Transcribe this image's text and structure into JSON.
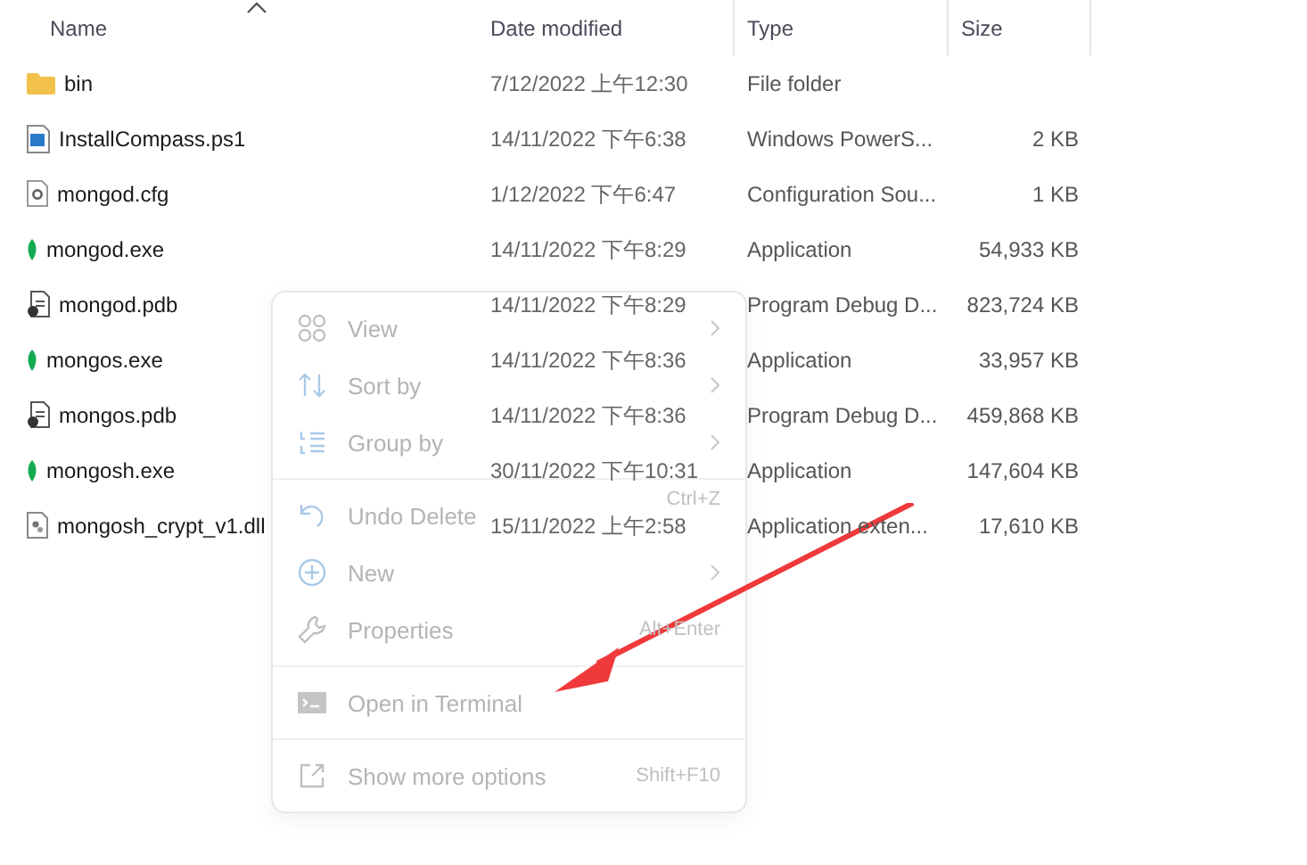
{
  "table": {
    "columns": [
      {
        "label": "Name",
        "sorted": true
      },
      {
        "label": "Date modified",
        "sorted": false
      },
      {
        "label": "Type",
        "sorted": false
      },
      {
        "label": "Size",
        "sorted": false
      }
    ],
    "rows": [
      {
        "kind": "folder",
        "name": "bin",
        "date": "7/12/2022 上午12:30",
        "type": "File folder"
      },
      {
        "kind": "script",
        "name": "InstallCompass.ps1",
        "date": "14/11/2022 下午6:38",
        "type": "Windows PowerS...",
        "size": "2 KB"
      },
      {
        "kind": "config",
        "name": "mongod.cfg",
        "date": "1/12/2022 下午6:47",
        "type": "Configuration Sou...",
        "size": "1 KB"
      },
      {
        "kind": "exe",
        "name": "mongod.exe",
        "date": "14/11/2022 下午8:29",
        "type": "Application",
        "size": "54,933 KB"
      },
      {
        "kind": "pdb",
        "name": "mongod.pdb",
        "date": "14/11/2022 下午8:29",
        "type": "Program Debug D...",
        "size": "823,724 KB"
      },
      {
        "kind": "exe",
        "name": "mongos.exe",
        "date": "14/11/2022 下午8:36",
        "type": "Application",
        "size": "33,957 KB"
      },
      {
        "kind": "pdb",
        "name": "mongos.pdb",
        "date": "14/11/2022 下午8:36",
        "type": "Program Debug D...",
        "size": "459,868 KB"
      },
      {
        "kind": "exe",
        "name": "mongosh.exe",
        "date": "30/11/2022 下午10:31",
        "type": "Application",
        "size": "147,604 KB"
      },
      {
        "kind": "dll",
        "name": "mongosh_crypt_v1.dll",
        "date": "15/11/2022 上午2:58",
        "type": "Application exten...",
        "size": "17,610 KB"
      }
    ]
  },
  "context_menu": {
    "groups": [
      [
        {
          "kind": "view",
          "label": "View",
          "submenu": true
        },
        {
          "kind": "sort",
          "label": "Sort by",
          "submenu": true
        },
        {
          "kind": "group",
          "label": "Group by",
          "submenu": true
        }
      ],
      [
        {
          "kind": "undo",
          "label": "Undo Delete",
          "shortcut": "Ctrl+Z",
          "submenu": false
        },
        {
          "kind": "new",
          "label": "New",
          "submenu": true
        },
        {
          "kind": "properties",
          "label": "Properties",
          "shortcut": "Alt+Enter",
          "submenu": false
        }
      ],
      [
        {
          "kind": "terminal",
          "label": "Open in Terminal",
          "submenu": false
        }
      ],
      [
        {
          "kind": "more",
          "label": "Show more options",
          "shortcut": "Shift+F10",
          "submenu": false
        }
      ]
    ]
  }
}
